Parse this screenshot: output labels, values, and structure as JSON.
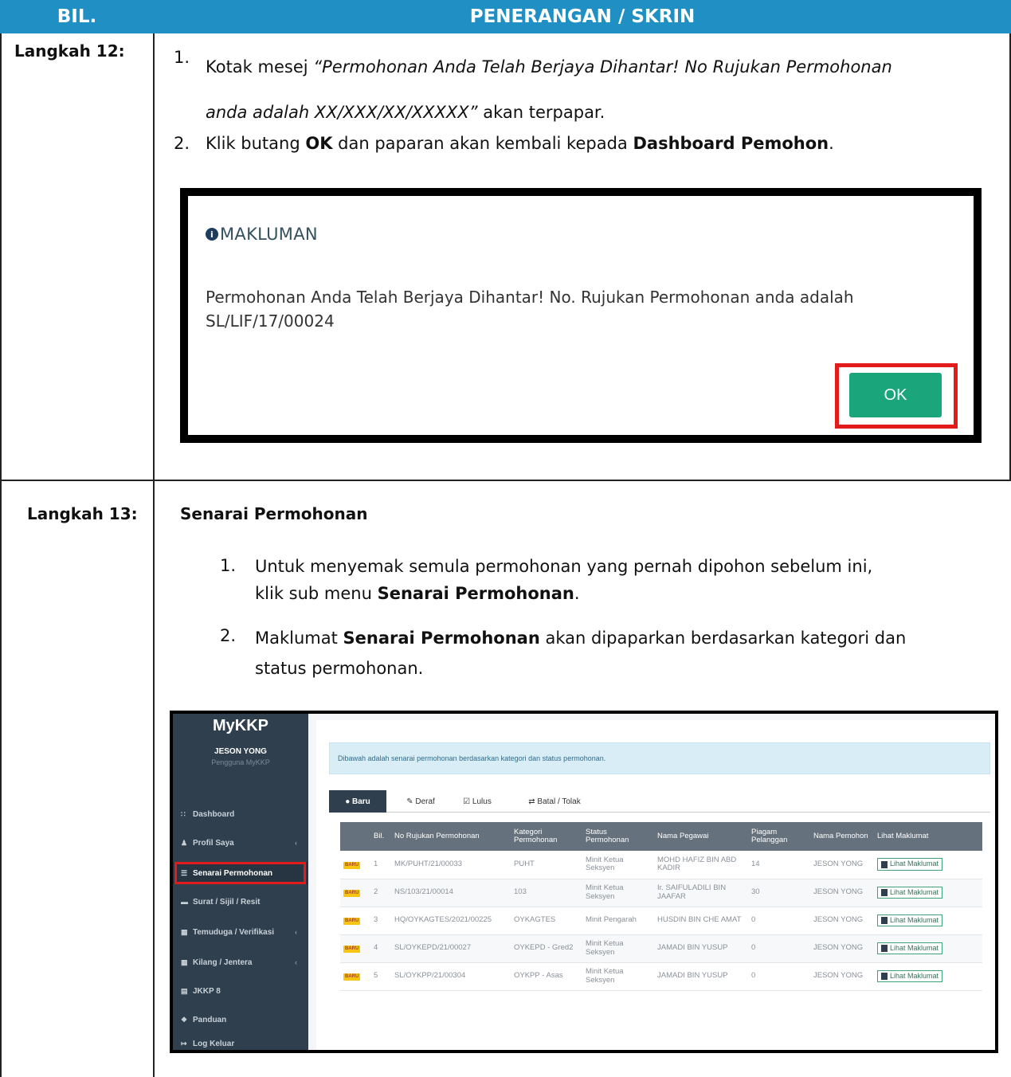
{
  "header": {
    "bil": "BIL.",
    "penerangan": "PENERANGAN / SKRIN"
  },
  "step12": {
    "label": "Langkah 12:",
    "item1_num": "1.",
    "item1_pre": "Kotak mesej ",
    "item1_quote_line1": "“Permohonan Anda Telah Berjaya Dihantar! No Rujukan Permohonan",
    "item1_quote_line2": "anda adalah XX/XXX/XX/XXXXX”",
    "item1_post": " akan terpapar.",
    "item2_num": "2.",
    "item2_a": "Klik butang ",
    "item2_b": "OK",
    "item2_c": " dan paparan akan kembali kepada ",
    "item2_d": "Dashboard Pemohon",
    "item2_e": ".",
    "dialog": {
      "title": "MAKLUMAN",
      "info_icon_glyph": "i",
      "message": "Permohonan Anda Telah Berjaya Dihantar! No. Rujukan Permohonan anda adalah SL/LIF/17/00024",
      "ok_label": "OK"
    }
  },
  "step13": {
    "label": "Langkah 13:",
    "heading": "Senarai Permohonan",
    "item1_num": "1.",
    "item1_a": "Untuk menyemak semula permohonan yang pernah dipohon sebelum ini,",
    "item1_b": "klik sub menu ",
    "item1_c": "Senarai Permohonan",
    "item1_d": ".",
    "item2_num": "2.",
    "item2_a": "Maklumat ",
    "item2_b": "Senarai Permohonan",
    "item2_c": " akan dipaparkan berdasarkan kategori dan",
    "item2_d": "status permohonan."
  },
  "app": {
    "brand": "MyKKP",
    "user_name": "JESON YONG",
    "user_role": "Pengguna MyKKP",
    "sidebar": [
      {
        "label": "Dashboard",
        "icon": "∷",
        "chevron": ""
      },
      {
        "label": "Profil Saya",
        "icon": "♟",
        "chevron": "‹"
      },
      {
        "label": "Senarai Permohonan",
        "icon": "☰",
        "chevron": ""
      },
      {
        "label": "Surat / Sijil / Resit",
        "icon": "▬",
        "chevron": ""
      },
      {
        "label": "Temuduga / Verifikasi",
        "icon": "▦",
        "chevron": "‹"
      },
      {
        "label": "Kilang / Jentera",
        "icon": "▦",
        "chevron": "‹"
      },
      {
        "label": "JKKP 8",
        "icon": "▤",
        "chevron": ""
      },
      {
        "label": "Panduan",
        "icon": "❖",
        "chevron": ""
      },
      {
        "label": "Log Keluar",
        "icon": "↦",
        "chevron": ""
      }
    ],
    "alert": "Dibawah adalah senarai permohonan berdasarkan kategori dan status permohonan.",
    "tabs": [
      {
        "label": "●  Baru"
      },
      {
        "label": "✎  Deraf"
      },
      {
        "label": "☑  Lulus"
      },
      {
        "label": "⇄  Batal / Tolak"
      }
    ],
    "columns": [
      "",
      "Bil.",
      "No Rujukan Permohonan",
      "Kategori Permohonan",
      "Status Permohonan",
      "Nama Pegawai",
      "Piagam Pelanggan",
      "Nama Pemohon",
      "Lihat Maklumat"
    ],
    "badge": "BARU",
    "view_label": "Lihat Maklumat",
    "rows": [
      {
        "bil": "1",
        "ref": "MK/PUHT/21/00033",
        "kategori": "PUHT",
        "status": "Minit Ketua Seksyen",
        "pegawai": "MOHD HAFIZ BIN ABD KADIR",
        "piagam": "14",
        "pemohon": "JESON YONG"
      },
      {
        "bil": "2",
        "ref": "NS/103/21/00014",
        "kategori": "103",
        "status": "Minit Ketua Seksyen",
        "pegawai": "Ir. SAIFULADILI BIN JAAFAR",
        "piagam": "30",
        "pemohon": "JESON YONG"
      },
      {
        "bil": "3",
        "ref": "HQ/OYKAGTES/2021/00225",
        "kategori": "OYKAGTES",
        "status": "Minit Pengarah",
        "pegawai": "HUSDIN BIN CHE AMAT",
        "piagam": "0",
        "pemohon": "JESON YONG"
      },
      {
        "bil": "4",
        "ref": "SL/OYKEPD/21/00027",
        "kategori": "OYKEPD - Gred2",
        "status": "Minit Ketua Seksyen",
        "pegawai": "JAMADI BIN YUSUP",
        "piagam": "0",
        "pemohon": "JESON YONG"
      },
      {
        "bil": "5",
        "ref": "SL/OYKPP/21/00304",
        "kategori": "OYKPP - Asas",
        "status": "Minit Ketua Seksyen",
        "pegawai": "JAMADI BIN YUSUP",
        "piagam": "0",
        "pemohon": "JESON YONG"
      }
    ]
  }
}
